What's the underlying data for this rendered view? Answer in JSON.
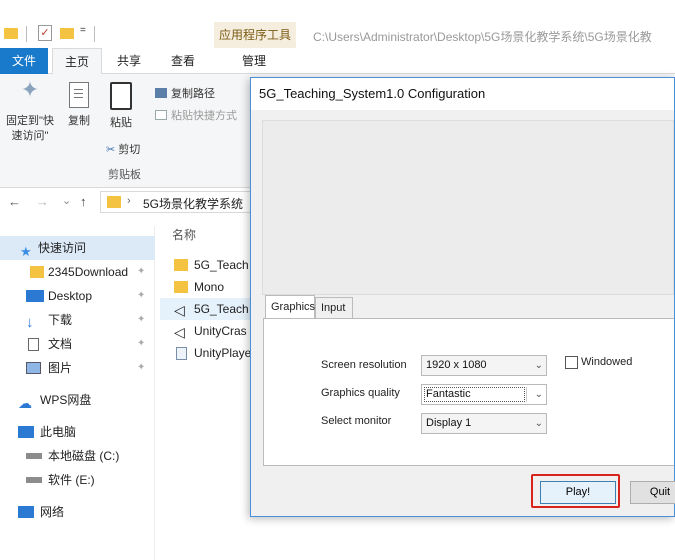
{
  "quick_access_toolbar": {
    "dropdown_glyph": "="
  },
  "contextual_tab_group": "应用程序工具",
  "window_path_title": "C:\\Users\\Administrator\\Desktop\\5G场景化教学系统\\5G场景化教",
  "ribbon_tabs": {
    "file": "文件",
    "home": "主页",
    "share": "共享",
    "view": "查看",
    "manage": "管理"
  },
  "ribbon": {
    "pin_quick_access": "固定到\"快速访问\"",
    "copy": "复制",
    "paste": "粘贴",
    "copy_path": "复制路径",
    "paste_shortcut": "粘贴快捷方式",
    "cut": "剪切",
    "clipboard_group": "剪贴板"
  },
  "address_bar": {
    "back": "←",
    "forward": "→",
    "recent": "⌄",
    "up": "↑",
    "separator": "›",
    "path": "5G场景化教学系统"
  },
  "sidebar": {
    "items": [
      {
        "label": "快速访问",
        "icon": "star-icon"
      },
      {
        "label": "2345Download",
        "icon": "folder-icon",
        "pinned": true
      },
      {
        "label": "Desktop",
        "icon": "desktop-icon",
        "pinned": true
      },
      {
        "label": "下载",
        "icon": "download-icon",
        "pinned": true
      },
      {
        "label": "文档",
        "icon": "document-icon",
        "pinned": true
      },
      {
        "label": "图片",
        "icon": "picture-icon",
        "pinned": true
      },
      {
        "label": "WPS网盘",
        "icon": "cloud-icon"
      },
      {
        "label": "此电脑",
        "icon": "computer-icon"
      },
      {
        "label": "本地磁盘 (C:)",
        "icon": "drive-icon"
      },
      {
        "label": "软件 (E:)",
        "icon": "drive-icon"
      },
      {
        "label": "网络",
        "icon": "network-icon"
      }
    ]
  },
  "file_list": {
    "column_name": "名称",
    "files": [
      {
        "name": "5G_Teach",
        "icon": "folder-icon"
      },
      {
        "name": "Mono",
        "icon": "folder-icon"
      },
      {
        "name": "5G_Teach",
        "icon": "unity-icon"
      },
      {
        "name": "UnityCras",
        "icon": "unity-icon"
      },
      {
        "name": "UnityPlaye",
        "icon": "dll-icon"
      }
    ]
  },
  "dialog": {
    "title": "5G_Teaching_System1.0 Configuration",
    "tabs": [
      "Graphics",
      "Input"
    ],
    "screen_resolution_label": "Screen resolution",
    "screen_resolution_value": "1920 x 1080",
    "graphics_quality_label": "Graphics quality",
    "graphics_quality_value": "Fantastic",
    "select_monitor_label": "Select monitor",
    "select_monitor_value": "Display 1",
    "windowed_label": "Windowed",
    "windowed_checked": false,
    "play_button": "Play!",
    "quit_button": "Quit"
  },
  "colors": {
    "file_tab": "#1979ca",
    "dialog_border": "#4a90d9",
    "highlight": "#d9241b"
  }
}
